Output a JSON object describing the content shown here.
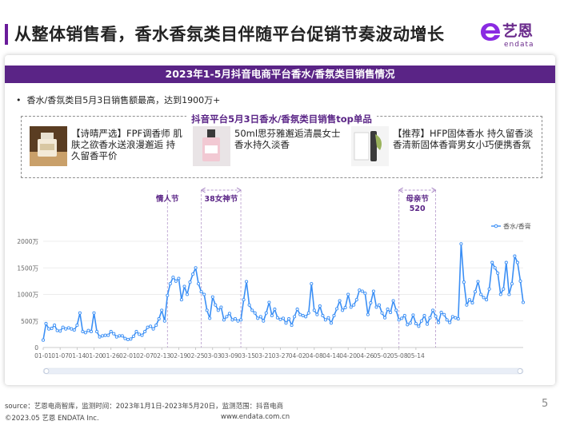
{
  "page": {
    "title": "从整体销售看，香水香氛类目伴随平台促销节奏波动增长",
    "logo_cn": "艺恩",
    "logo_en": "endata",
    "page_number": "5"
  },
  "card": {
    "header": "2023年1-5月抖音电商平台香水/香氛类目销售情况",
    "bullet": "香水/香氛类目5月3日销售额最高，达到1900万+",
    "top_section_title": "抖音平台5月3日香水/香氛类目销售top单品",
    "products": [
      {
        "text": "【诗晴严选】FPF调香师 肌肤之欲香水送浪漫邂逅 持久留香平价",
        "image": "perfume-bottle-icon"
      },
      {
        "text": "50ml思芬雅邂逅清晨女士香水持久淡香",
        "image": "perfume-bottle-icon"
      },
      {
        "text": "【推荐】HFP固体香水 持久留香淡香清新固体香膏男女小巧便携香氛",
        "image": "solid-perfume-icon"
      }
    ]
  },
  "chart_data": {
    "type": "line",
    "legend": [
      "香水/香膏"
    ],
    "legend_position": "top-right",
    "ylim": [
      0,
      2000
    ],
    "y_ticks": [
      "0",
      "500万",
      "1000万",
      "1500万",
      "2000万"
    ],
    "x_tick_labels": [
      "01-01",
      "01-07",
      "01-14",
      "01-20",
      "01-26",
      "02-01",
      "02-07",
      "02-13",
      "02-19",
      "02-25",
      "03-03",
      "03-09",
      "03-15",
      "03-21",
      "03-27",
      "04-02",
      "04-08",
      "04-14",
      "04-20",
      "04-26",
      "05-02",
      "05-08",
      "05-14"
    ],
    "grid": true,
    "color": "#3b8ff5",
    "events": [
      {
        "label": "情人节",
        "start_index": 44,
        "end_index": 44
      },
      {
        "label": "38女神节",
        "start_index": 56,
        "end_index": 70
      },
      {
        "label": "母亲节",
        "label2": "520",
        "start_index": 126,
        "end_index": 139
      }
    ],
    "series": [
      {
        "name": "香水/香膏",
        "values": [
          140,
          450,
          350,
          360,
          420,
          320,
          310,
          380,
          350,
          370,
          350,
          330,
          420,
          650,
          300,
          280,
          320,
          300,
          650,
          300,
          200,
          220,
          230,
          230,
          300,
          260,
          200,
          220,
          220,
          170,
          150,
          160,
          210,
          300,
          250,
          230,
          300,
          380,
          400,
          350,
          420,
          540,
          700,
          500,
          980,
          1200,
          1320,
          1250,
          1300,
          900,
          1150,
          1000,
          1230,
          1380,
          1500,
          1200,
          1050,
          1000,
          700,
          550,
          950,
          800,
          700,
          760,
          520,
          580,
          640,
          520,
          540,
          500,
          520,
          900,
          1240,
          800,
          700,
          650,
          550,
          580,
          500,
          650,
          850,
          600,
          720,
          560,
          530,
          550,
          460,
          540,
          420,
          580,
          720,
          620,
          600,
          580,
          650,
          1200,
          700,
          620,
          780,
          600,
          520,
          560,
          460,
          600,
          730,
          880,
          700,
          750,
          1000,
          760,
          800,
          900,
          1080,
          1060,
          1020,
          620,
          840,
          1060,
          760,
          800,
          650,
          560,
          720,
          660,
          880,
          700,
          520,
          550,
          600,
          430,
          460,
          610,
          450,
          400,
          500,
          600,
          440,
          560,
          700,
          590,
          470,
          660,
          620,
          520,
          470,
          580,
          560,
          540,
          1950,
          1230,
          800,
          900,
          840,
          1050,
          1240,
          1000,
          940,
          900,
          1100,
          1600,
          1500,
          1400,
          1000,
          1100,
          1600,
          1000,
          1200,
          1720,
          1600,
          1250,
          850
        ]
      }
    ]
  },
  "footer": {
    "source": "source：艺恩电商智库，监测时间：2023年1月1日-2023年5月20日，监测范围：抖音电商",
    "copyright": "©2023.05 艺恩 ENDATA Inc.",
    "url": "www.endata.com.cn"
  }
}
